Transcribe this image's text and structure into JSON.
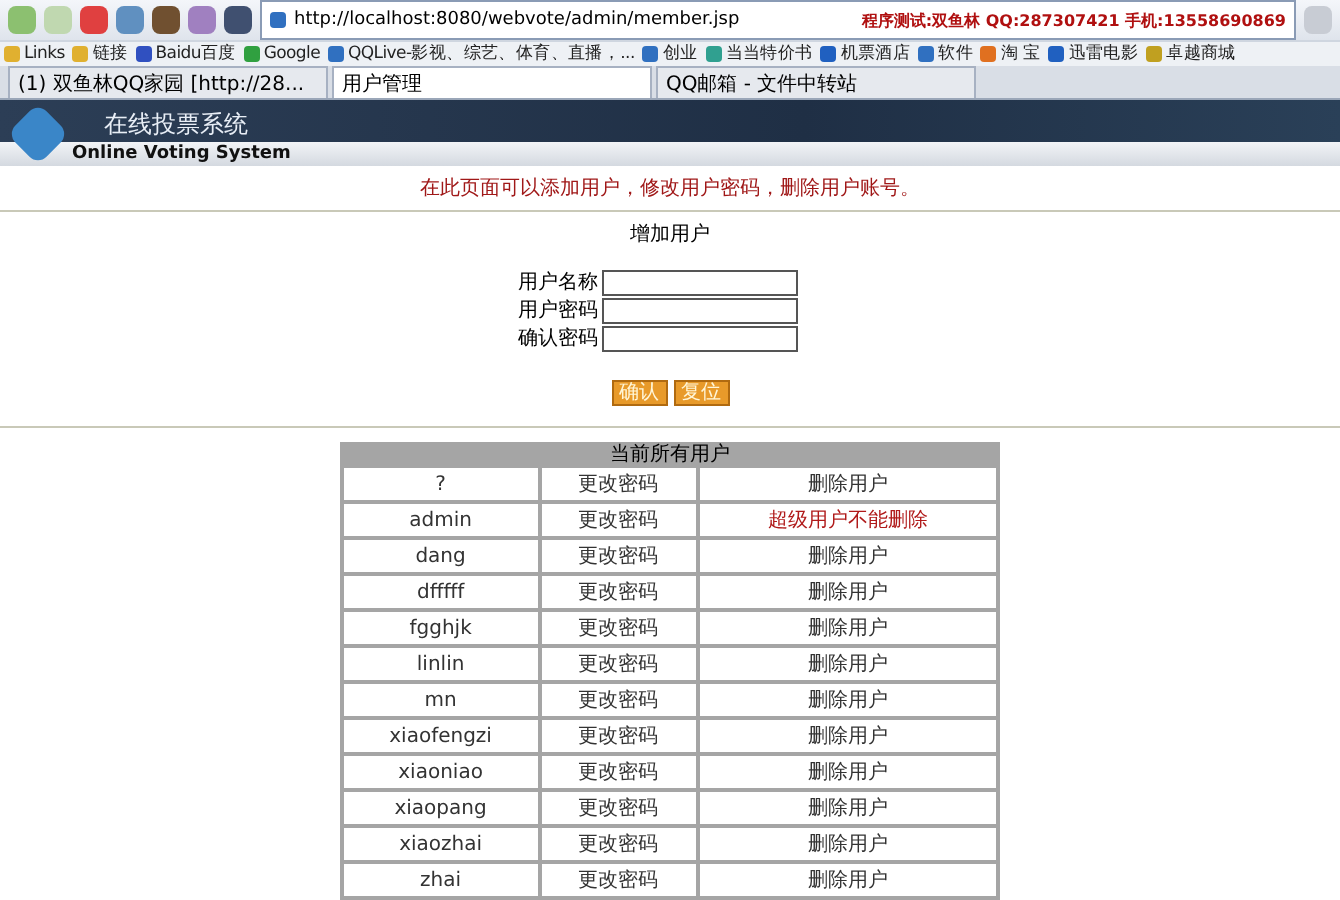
{
  "browser": {
    "address": "http://localhost:8080/webvote/admin/member.jsp",
    "banner": "程序测试:双鱼林 QQ:287307421 手机:13558690869"
  },
  "bookmarks": [
    "Links",
    "链接",
    "Baidu百度",
    "Google",
    "QQLive-影视、综艺、体育、直播，...",
    "创业",
    "当当特价书",
    "机票酒店",
    "软件",
    "淘 宝",
    "迅雷电影",
    "卓越商城"
  ],
  "tabs": [
    {
      "label": "(1) 双鱼林QQ家园 [http://28...",
      "selected": false
    },
    {
      "label": "用户管理",
      "selected": true
    },
    {
      "label": "QQ邮箱 - 文件中转站",
      "selected": false
    }
  ],
  "header": {
    "title": "在线投票系统",
    "subtitle": "Online Voting System"
  },
  "notice": "在此页面可以添加用户，修改用户密码，删除用户账号。",
  "add_form": {
    "title": "增加用户",
    "fields": [
      {
        "label": "用户名称"
      },
      {
        "label": "用户密码"
      },
      {
        "label": "确认密码"
      }
    ],
    "buttons": [
      "确认",
      "复位"
    ]
  },
  "users_table": {
    "title": "当前所有用户",
    "rows": [
      {
        "name": "?",
        "change": "更改密码",
        "delete": "删除用户",
        "deletable": true
      },
      {
        "name": "admin",
        "change": "更改密码",
        "delete": "超级用户不能删除",
        "deletable": false
      },
      {
        "name": "dang",
        "change": "更改密码",
        "delete": "删除用户",
        "deletable": true
      },
      {
        "name": "dfffff",
        "change": "更改密码",
        "delete": "删除用户",
        "deletable": true
      },
      {
        "name": "fgghjk",
        "change": "更改密码",
        "delete": "删除用户",
        "deletable": true
      },
      {
        "name": "linlin",
        "change": "更改密码",
        "delete": "删除用户",
        "deletable": true
      },
      {
        "name": "mn",
        "change": "更改密码",
        "delete": "删除用户",
        "deletable": true
      },
      {
        "name": "xiaofengzi",
        "change": "更改密码",
        "delete": "删除用户",
        "deletable": true
      },
      {
        "name": "xiaoniao",
        "change": "更改密码",
        "delete": "删除用户",
        "deletable": true
      },
      {
        "name": "xiaopang",
        "change": "更改密码",
        "delete": "删除用户",
        "deletable": true
      },
      {
        "name": "xiaozhai",
        "change": "更改密码",
        "delete": "删除用户",
        "deletable": true
      },
      {
        "name": "zhai",
        "change": "更改密码",
        "delete": "删除用户",
        "deletable": true
      }
    ]
  }
}
